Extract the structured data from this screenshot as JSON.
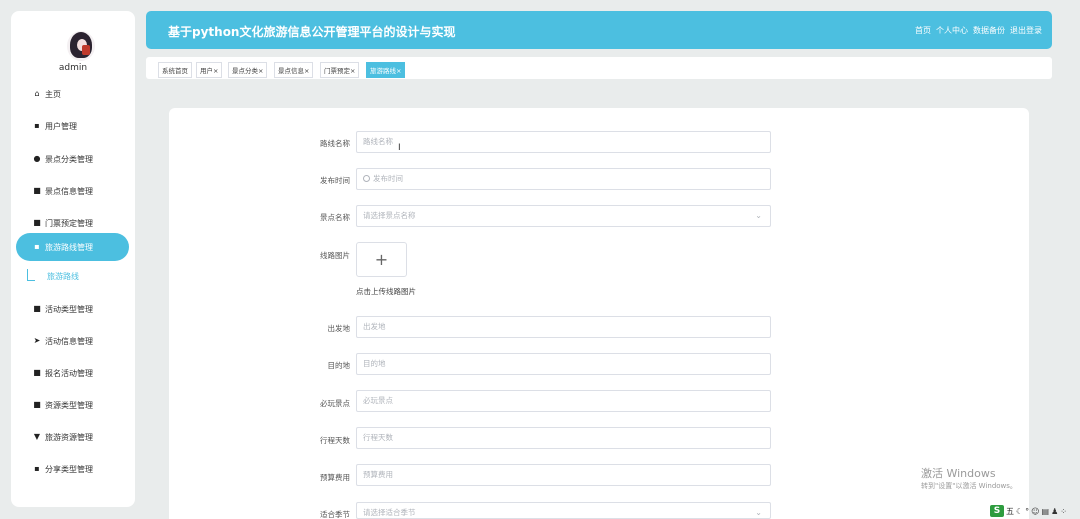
{
  "sidebar": {
    "username": "admin",
    "items": [
      {
        "label": "主页",
        "icon": "home-icon"
      },
      {
        "label": "用户管理",
        "icon": "grid-icon"
      },
      {
        "label": "景点分类管理",
        "icon": "user-icon"
      },
      {
        "label": "景点信息管理",
        "icon": "briefcase-icon"
      },
      {
        "label": "门票预定管理",
        "icon": "comment-icon"
      },
      {
        "label": "旅游路线管理",
        "icon": "grid-icon"
      },
      {
        "label": "活动类型管理",
        "icon": "book-icon"
      },
      {
        "label": "活动信息管理",
        "icon": "send-icon"
      },
      {
        "label": "报名活动管理",
        "icon": "clipboard-icon"
      },
      {
        "label": "资源类型管理",
        "icon": "clipboard-x-icon"
      },
      {
        "label": "旅游资源管理",
        "icon": "pin-icon"
      },
      {
        "label": "分享类型管理",
        "icon": "grid-icon"
      }
    ],
    "sub_item": "旅游路线"
  },
  "header": {
    "title": "基于python文化旅游信息公开管理平台的设计与实现",
    "links": [
      "首页",
      "个人中心",
      "数据备份",
      "退出登录"
    ]
  },
  "tabs": [
    {
      "label": "系统首页"
    },
    {
      "label": "用户×"
    },
    {
      "label": "景点分类×"
    },
    {
      "label": "景点信息×"
    },
    {
      "label": "门票预定×"
    },
    {
      "label": "旅游路线×",
      "active": true
    }
  ],
  "form": {
    "route_name": {
      "label": "路线名称",
      "placeholder": "路线名称"
    },
    "publish_time": {
      "label": "发布时间",
      "placeholder": "发布时间"
    },
    "spot_name": {
      "label": "景点名称",
      "placeholder": "请选择景点名称"
    },
    "route_image": {
      "label": "线路图片",
      "hint": "点击上传线路图片",
      "plus": "+"
    },
    "departure": {
      "label": "出发地",
      "placeholder": "出发地"
    },
    "destination": {
      "label": "目的地",
      "placeholder": "目的地"
    },
    "must_see": {
      "label": "必玩景点",
      "placeholder": "必玩景点"
    },
    "days": {
      "label": "行程天数",
      "placeholder": "行程天数"
    },
    "budget": {
      "label": "预算费用",
      "placeholder": "预算费用"
    },
    "season": {
      "label": "适合季节",
      "placeholder": "请选择适合季节"
    }
  },
  "watermark": {
    "line1": "激活 Windows",
    "line2": "转到\"设置\"以激活 Windows。"
  },
  "tray": {
    "ime": "五"
  }
}
